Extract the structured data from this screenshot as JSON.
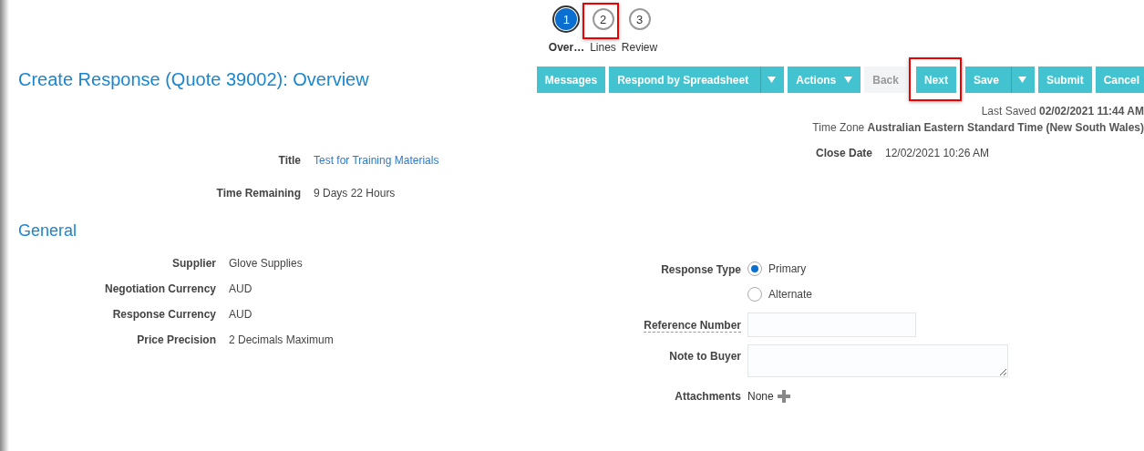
{
  "train": [
    {
      "number": "1",
      "label": "Over…",
      "selected": true,
      "highlighted": false
    },
    {
      "number": "2",
      "label": "Lines",
      "selected": false,
      "highlighted": true
    },
    {
      "number": "3",
      "label": "Review",
      "selected": false,
      "highlighted": false
    }
  ],
  "page_title": "Create Response (Quote 39002): Overview",
  "toolbar": [
    {
      "label": "Messages",
      "kind": "plain",
      "disabled": false,
      "highlighted": false
    },
    {
      "label": "Respond by Spreadsheet",
      "kind": "split",
      "disabled": false,
      "highlighted": false
    },
    {
      "label": "Actions",
      "kind": "menu",
      "disabled": false,
      "highlighted": false
    },
    {
      "label": "Back",
      "kind": "plain",
      "disabled": true,
      "highlighted": false
    },
    {
      "label": "Next",
      "kind": "plain",
      "disabled": false,
      "highlighted": true
    },
    {
      "label": "Save",
      "kind": "split",
      "disabled": false,
      "highlighted": false
    },
    {
      "label": "Submit",
      "kind": "plain",
      "disabled": false,
      "highlighted": false
    },
    {
      "label": "Cancel",
      "kind": "plain",
      "disabled": false,
      "highlighted": false
    }
  ],
  "last_saved": {
    "label": "Last Saved",
    "value": "02/02/2021 11:44 AM"
  },
  "time_zone": {
    "label": "Time Zone",
    "value": "Australian Eastern Standard Time (New South Wales)"
  },
  "header_fields": [
    {
      "label": "Title",
      "value": "Test for Training Materials",
      "kind": "link"
    },
    {
      "label": "Time Remaining",
      "value": "9 Days 22 Hours",
      "kind": "text"
    }
  ],
  "close_date": {
    "label": "Close Date",
    "value": "12/02/2021 10:26 AM"
  },
  "general": {
    "heading": "General",
    "fields": [
      {
        "label": "Supplier",
        "value": "Glove Supplies"
      },
      {
        "label": "Negotiation Currency",
        "value": "AUD"
      },
      {
        "label": "Response Currency",
        "value": "AUD"
      },
      {
        "label": "Price Precision",
        "value": "2 Decimals Maximum"
      }
    ],
    "response_type": {
      "label": "Response Type",
      "options": [
        {
          "label": "Primary",
          "selected": true
        },
        {
          "label": "Alternate",
          "selected": false
        }
      ]
    },
    "reference_number": {
      "label": "Reference Number"
    },
    "note_to_buyer": {
      "label": "Note to Buyer"
    },
    "attachments": {
      "label": "Attachments",
      "value": "None"
    }
  }
}
